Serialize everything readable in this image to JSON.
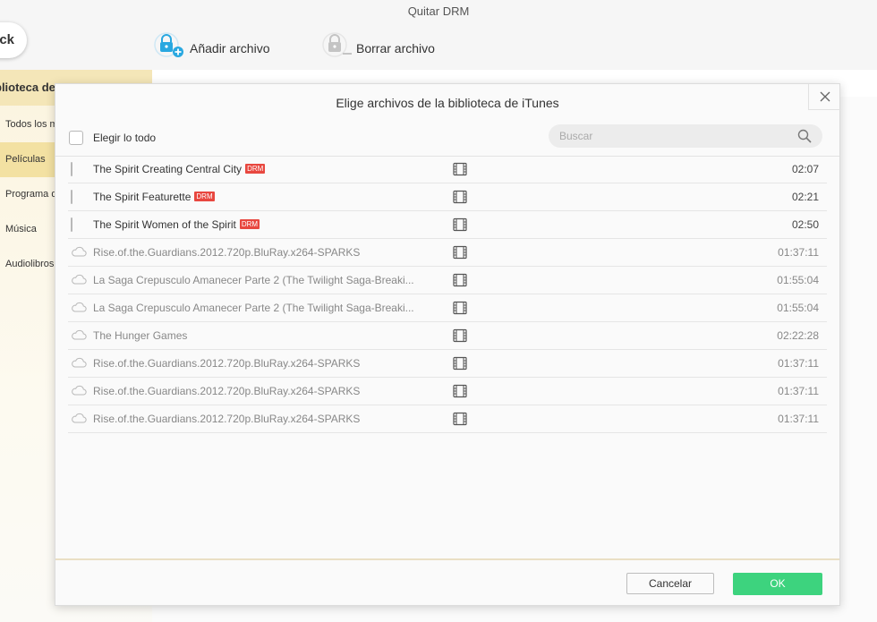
{
  "app": {
    "title": "Quitar DRM",
    "back_label": "ck",
    "toolbar": {
      "add_label": "Añadir archivo",
      "delete_label": "Borrar archivo"
    }
  },
  "sidebar": {
    "header": "blioteca de",
    "items": [
      {
        "label": "Todos los m",
        "active": false
      },
      {
        "label": "Películas",
        "active": true
      },
      {
        "label": "Programa d",
        "active": false
      },
      {
        "label": "Música",
        "active": false
      },
      {
        "label": "Audiolibros",
        "active": false
      }
    ]
  },
  "dialog": {
    "title": "Elige archivos de la biblioteca de iTunes",
    "select_all_label": "Elegir lo todo",
    "search_placeholder": "Buscar",
    "drm_badge": "DRM",
    "rows": [
      {
        "name": "The Spirit Creating Central City",
        "drm": true,
        "cloud": false,
        "duration": "02:07"
      },
      {
        "name": "The Spirit Featurette",
        "drm": true,
        "cloud": false,
        "duration": "02:21"
      },
      {
        "name": "The Spirit Women of the Spirit",
        "drm": true,
        "cloud": false,
        "duration": "02:50"
      },
      {
        "name": "Rise.of.the.Guardians.2012.720p.BluRay.x264-SPARKS",
        "drm": false,
        "cloud": true,
        "duration": "01:37:11"
      },
      {
        "name": "La Saga Crepusculo Amanecer Parte 2 (The Twilight Saga-Breaki...",
        "drm": false,
        "cloud": true,
        "duration": "01:55:04"
      },
      {
        "name": "La Saga Crepusculo Amanecer Parte 2 (The Twilight Saga-Breaki...",
        "drm": false,
        "cloud": true,
        "duration": "01:55:04"
      },
      {
        "name": "The Hunger Games",
        "drm": false,
        "cloud": true,
        "duration": "02:22:28"
      },
      {
        "name": "Rise.of.the.Guardians.2012.720p.BluRay.x264-SPARKS",
        "drm": false,
        "cloud": true,
        "duration": "01:37:11"
      },
      {
        "name": "Rise.of.the.Guardians.2012.720p.BluRay.x264-SPARKS",
        "drm": false,
        "cloud": true,
        "duration": "01:37:11"
      },
      {
        "name": "Rise.of.the.Guardians.2012.720p.BluRay.x264-SPARKS",
        "drm": false,
        "cloud": true,
        "duration": "01:37:11"
      }
    ],
    "cancel_label": "Cancelar",
    "ok_label": "OK"
  },
  "colors": {
    "accent_green": "#3dd37e",
    "drm_red": "#e8473f",
    "add_icon_blue": "#29a8e0",
    "sidebar_active": "#f3e1a2"
  },
  "icons": {
    "add": "lock-plus-icon",
    "delete": "lock-minus-icon",
    "close": "close-icon",
    "search": "search-icon",
    "movie": "film-icon",
    "cloud": "cloud-icon"
  }
}
